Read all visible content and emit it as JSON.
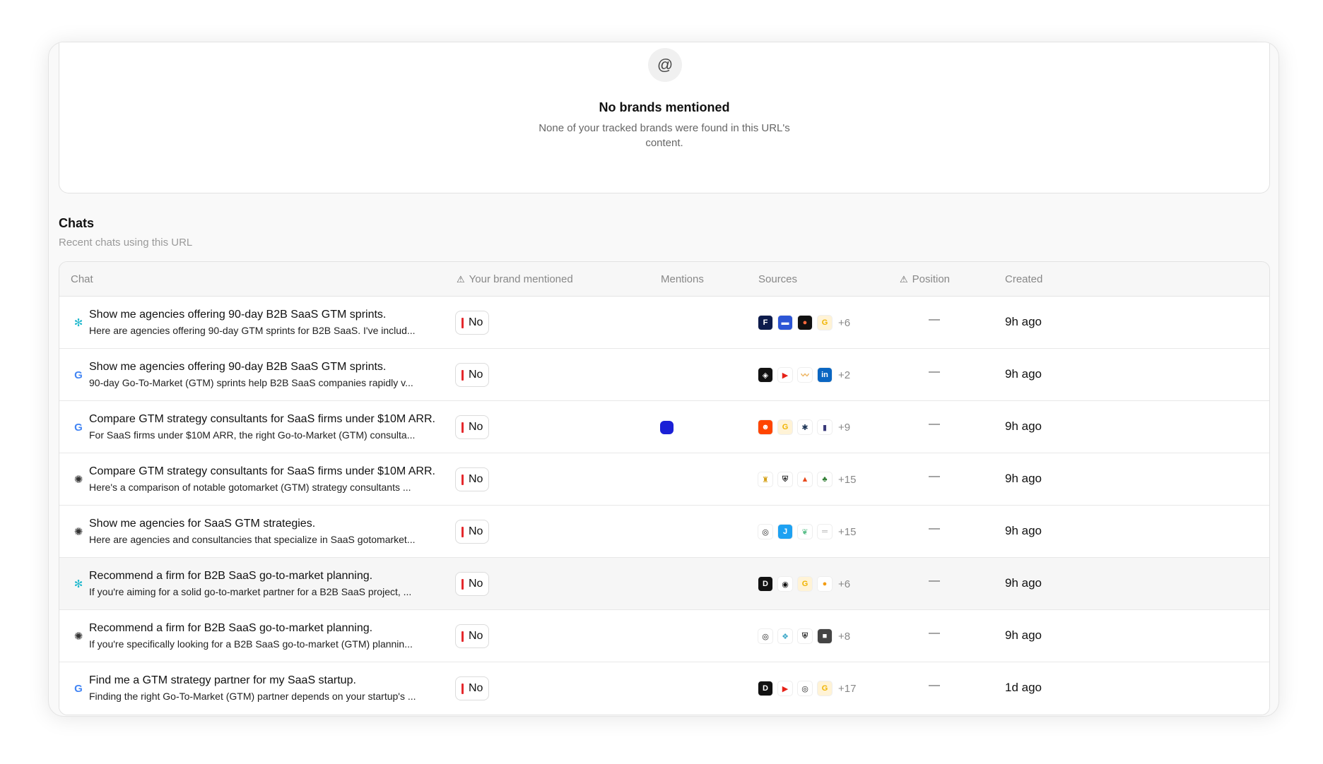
{
  "empty_state": {
    "icon": "at-icon",
    "title": "No brands mentioned",
    "description": "None of your tracked brands were found in this URL's content."
  },
  "chats_section": {
    "title": "Chats",
    "subtitle": "Recent chats using this URL"
  },
  "table": {
    "headers": {
      "chat": "Chat",
      "brand_mentioned": "Your brand mentioned",
      "mentions": "Mentions",
      "sources": "Sources",
      "position": "Position",
      "created": "Created"
    },
    "rows": [
      {
        "model": "perplexity",
        "title": "Show me agencies offering 90-day B2B SaaS GTM sprints.",
        "preview": "Here are agencies offering 90-day GTM sprints for B2B SaaS. I've includ...",
        "brand_mentioned": "No",
        "has_mention": false,
        "sources": [
          {
            "bg": "#0d1b4c",
            "fg": "#fff",
            "glyph": "F"
          },
          {
            "bg": "#2d56d6",
            "fg": "#fff",
            "glyph": "▬"
          },
          {
            "bg": "#111",
            "fg": "#ff6a3d",
            "glyph": "●"
          },
          {
            "bg": "#fff3d6",
            "fg": "#f0b400",
            "glyph": "G"
          }
        ],
        "sources_more": "+6",
        "position": "—",
        "created": "9h ago",
        "highlight": false
      },
      {
        "model": "google",
        "title": "Show me agencies offering 90-day B2B SaaS GTM sprints.",
        "preview": "90-day Go-To-Market (GTM) sprints help B2B SaaS companies rapidly v...",
        "brand_mentioned": "No",
        "has_mention": false,
        "sources": [
          {
            "bg": "#111",
            "fg": "#fff",
            "glyph": "◈"
          },
          {
            "bg": "#fff",
            "fg": "#e62117",
            "glyph": "▶"
          },
          {
            "bg": "#fff",
            "fg": "#e9a23b",
            "glyph": "〰"
          },
          {
            "bg": "#0a66c2",
            "fg": "#fff",
            "glyph": "in"
          }
        ],
        "sources_more": "+2",
        "position": "—",
        "created": "9h ago",
        "highlight": false
      },
      {
        "model": "google",
        "title": "Compare GTM strategy consultants for SaaS firms under $10M ARR.",
        "preview": "For SaaS firms under $10M ARR, the right Go-to-Market (GTM) consulta...",
        "brand_mentioned": "No",
        "has_mention": true,
        "sources": [
          {
            "bg": "#ff4500",
            "fg": "#fff",
            "glyph": "☻"
          },
          {
            "bg": "#fff3d6",
            "fg": "#f0b400",
            "glyph": "G"
          },
          {
            "bg": "#fff",
            "fg": "#1d3557",
            "glyph": "✱"
          },
          {
            "bg": "#fff",
            "fg": "#3a3a7a",
            "glyph": "▮"
          }
        ],
        "sources_more": "+9",
        "position": "—",
        "created": "9h ago",
        "highlight": false
      },
      {
        "model": "chatgpt",
        "title": "Compare GTM strategy consultants for SaaS firms under $10M ARR.",
        "preview": "Here's a comparison of notable gotomarket (GTM) strategy consultants ...",
        "brand_mentioned": "No",
        "has_mention": false,
        "sources": [
          {
            "bg": "#fff",
            "fg": "#d4a017",
            "glyph": "♜"
          },
          {
            "bg": "#fff",
            "fg": "#333",
            "glyph": "⛨"
          },
          {
            "bg": "#fff",
            "fg": "#e84a1c",
            "glyph": "▲"
          },
          {
            "bg": "#fff",
            "fg": "#2e7d32",
            "glyph": "♣"
          }
        ],
        "sources_more": "+15",
        "position": "—",
        "created": "9h ago",
        "highlight": false
      },
      {
        "model": "chatgpt",
        "title": "Show me agencies for SaaS GTM strategies.",
        "preview": "Here are agencies and consultancies that specialize in SaaS gotomarket...",
        "brand_mentioned": "No",
        "has_mention": false,
        "sources": [
          {
            "bg": "#fff",
            "fg": "#222",
            "glyph": "◎"
          },
          {
            "bg": "#1da1f2",
            "fg": "#fff",
            "glyph": "J"
          },
          {
            "bg": "#fff",
            "fg": "#5cbf8a",
            "glyph": "❦"
          },
          {
            "bg": "#fff",
            "fg": "#aaa",
            "glyph": "═"
          }
        ],
        "sources_more": "+15",
        "position": "—",
        "created": "9h ago",
        "highlight": false
      },
      {
        "model": "perplexity",
        "title": "Recommend a firm for B2B SaaS go-to-market planning.",
        "preview": "If you're aiming for a solid go-to-market partner for a B2B SaaS project, ...",
        "brand_mentioned": "No",
        "has_mention": false,
        "sources": [
          {
            "bg": "#111",
            "fg": "#fff",
            "glyph": "D"
          },
          {
            "bg": "#fff",
            "fg": "#111",
            "glyph": "◉"
          },
          {
            "bg": "#fff3d6",
            "fg": "#f0b400",
            "glyph": "G"
          },
          {
            "bg": "#fff",
            "fg": "#f39c12",
            "glyph": "●"
          }
        ],
        "sources_more": "+6",
        "position": "—",
        "created": "9h ago",
        "highlight": true
      },
      {
        "model": "chatgpt",
        "title": "Recommend a firm for B2B SaaS go-to-market planning.",
        "preview": "If you're specifically looking for a B2B SaaS go-to-market (GTM) plannin...",
        "brand_mentioned": "No",
        "has_mention": false,
        "sources": [
          {
            "bg": "#fff",
            "fg": "#222",
            "glyph": "◎"
          },
          {
            "bg": "#fff",
            "fg": "#3fa9c9",
            "glyph": "❖"
          },
          {
            "bg": "#fff",
            "fg": "#333",
            "glyph": "⛨"
          },
          {
            "bg": "#444",
            "fg": "#fff",
            "glyph": "■"
          }
        ],
        "sources_more": "+8",
        "position": "—",
        "created": "9h ago",
        "highlight": false
      },
      {
        "model": "google",
        "title": "Find me a GTM strategy partner for my SaaS startup.",
        "preview": "Finding the right Go-To-Market (GTM) partner depends on your startup's ...",
        "brand_mentioned": "No",
        "has_mention": false,
        "sources": [
          {
            "bg": "#111",
            "fg": "#fff",
            "glyph": "D"
          },
          {
            "bg": "#fff",
            "fg": "#e62117",
            "glyph": "▶"
          },
          {
            "bg": "#fff",
            "fg": "#222",
            "glyph": "◎"
          },
          {
            "bg": "#fff3d6",
            "fg": "#f0b400",
            "glyph": "G"
          }
        ],
        "sources_more": "+17",
        "position": "—",
        "created": "1d ago",
        "highlight": false
      }
    ]
  },
  "colors": {
    "no_bar": "#e5292d",
    "mention_dot": "#1b20d6",
    "background": "#f9f9f9"
  }
}
